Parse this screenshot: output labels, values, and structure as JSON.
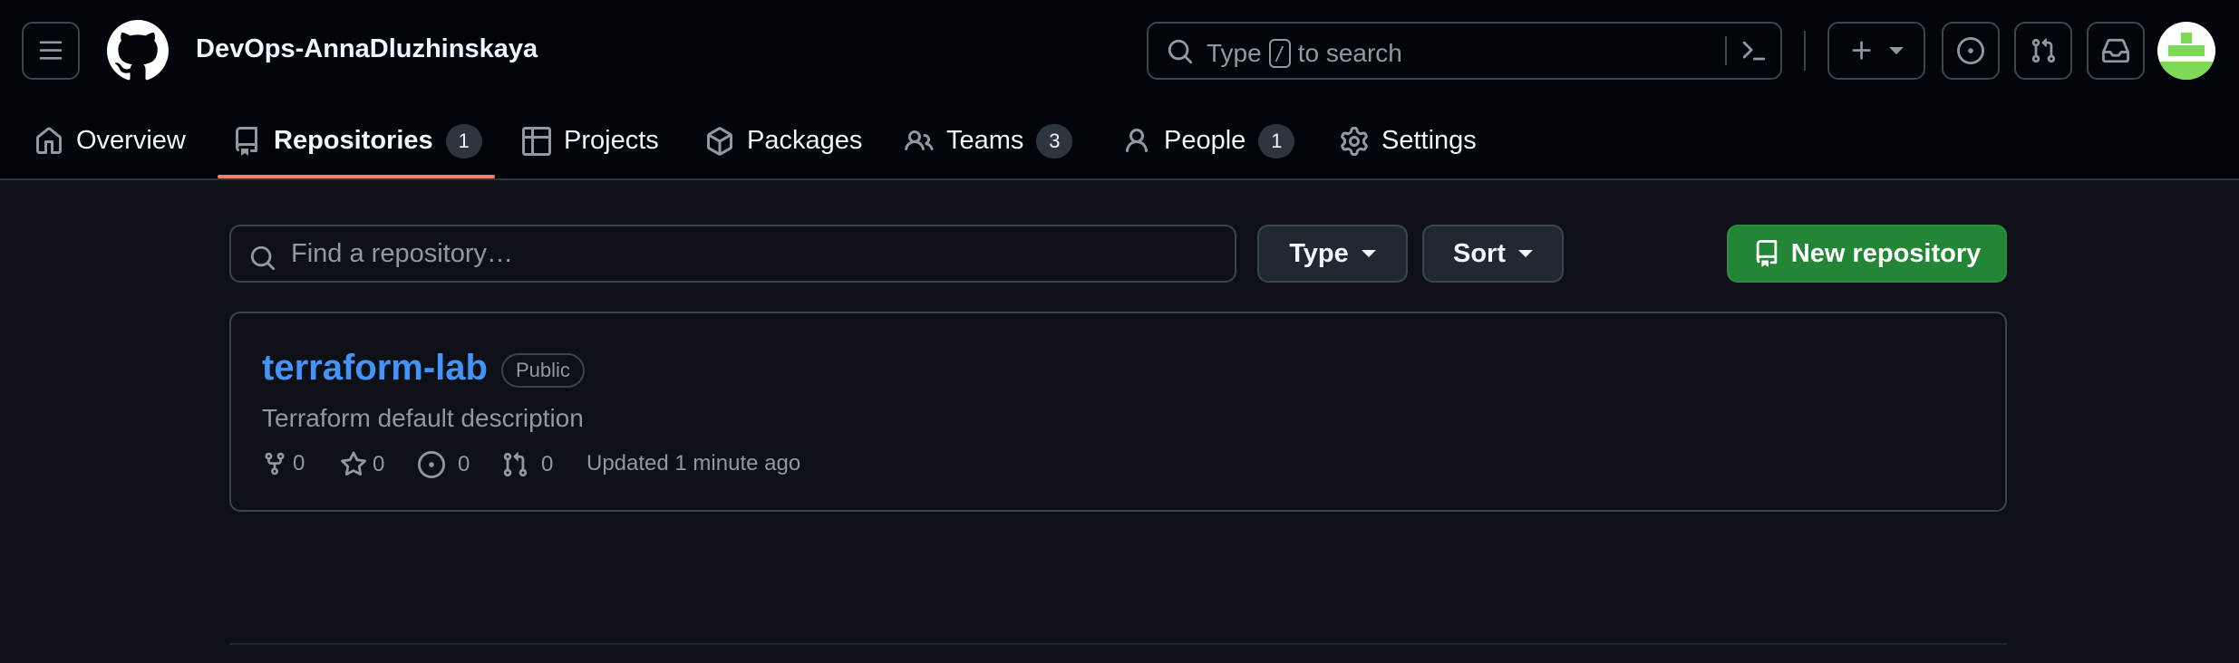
{
  "header": {
    "org_name": "DevOps-AnnaDluzhinskaya",
    "search": {
      "prefix": "Type",
      "key": "/",
      "suffix": "to search"
    }
  },
  "tabs": [
    {
      "label": "Overview"
    },
    {
      "label": "Repositories",
      "count": "1",
      "active": true
    },
    {
      "label": "Projects"
    },
    {
      "label": "Packages"
    },
    {
      "label": "Teams",
      "count": "3"
    },
    {
      "label": "People",
      "count": "1"
    },
    {
      "label": "Settings"
    }
  ],
  "filters": {
    "find_placeholder": "Find a repository…",
    "type_label": "Type",
    "sort_label": "Sort",
    "new_repo_label": "New repository"
  },
  "repos": [
    {
      "name": "terraform-lab",
      "visibility": "Public",
      "description": "Terraform default description",
      "forks": "0",
      "stars": "0",
      "issues": "0",
      "pull_requests": "0",
      "updated": "Updated 1 minute ago"
    }
  ],
  "colors": {
    "background": "#0d1117",
    "header_bg": "#010409",
    "accent_underline": "#f78166",
    "link": "#4493f8",
    "primary_button": "#238636",
    "avatar_green": "#7ed957"
  }
}
